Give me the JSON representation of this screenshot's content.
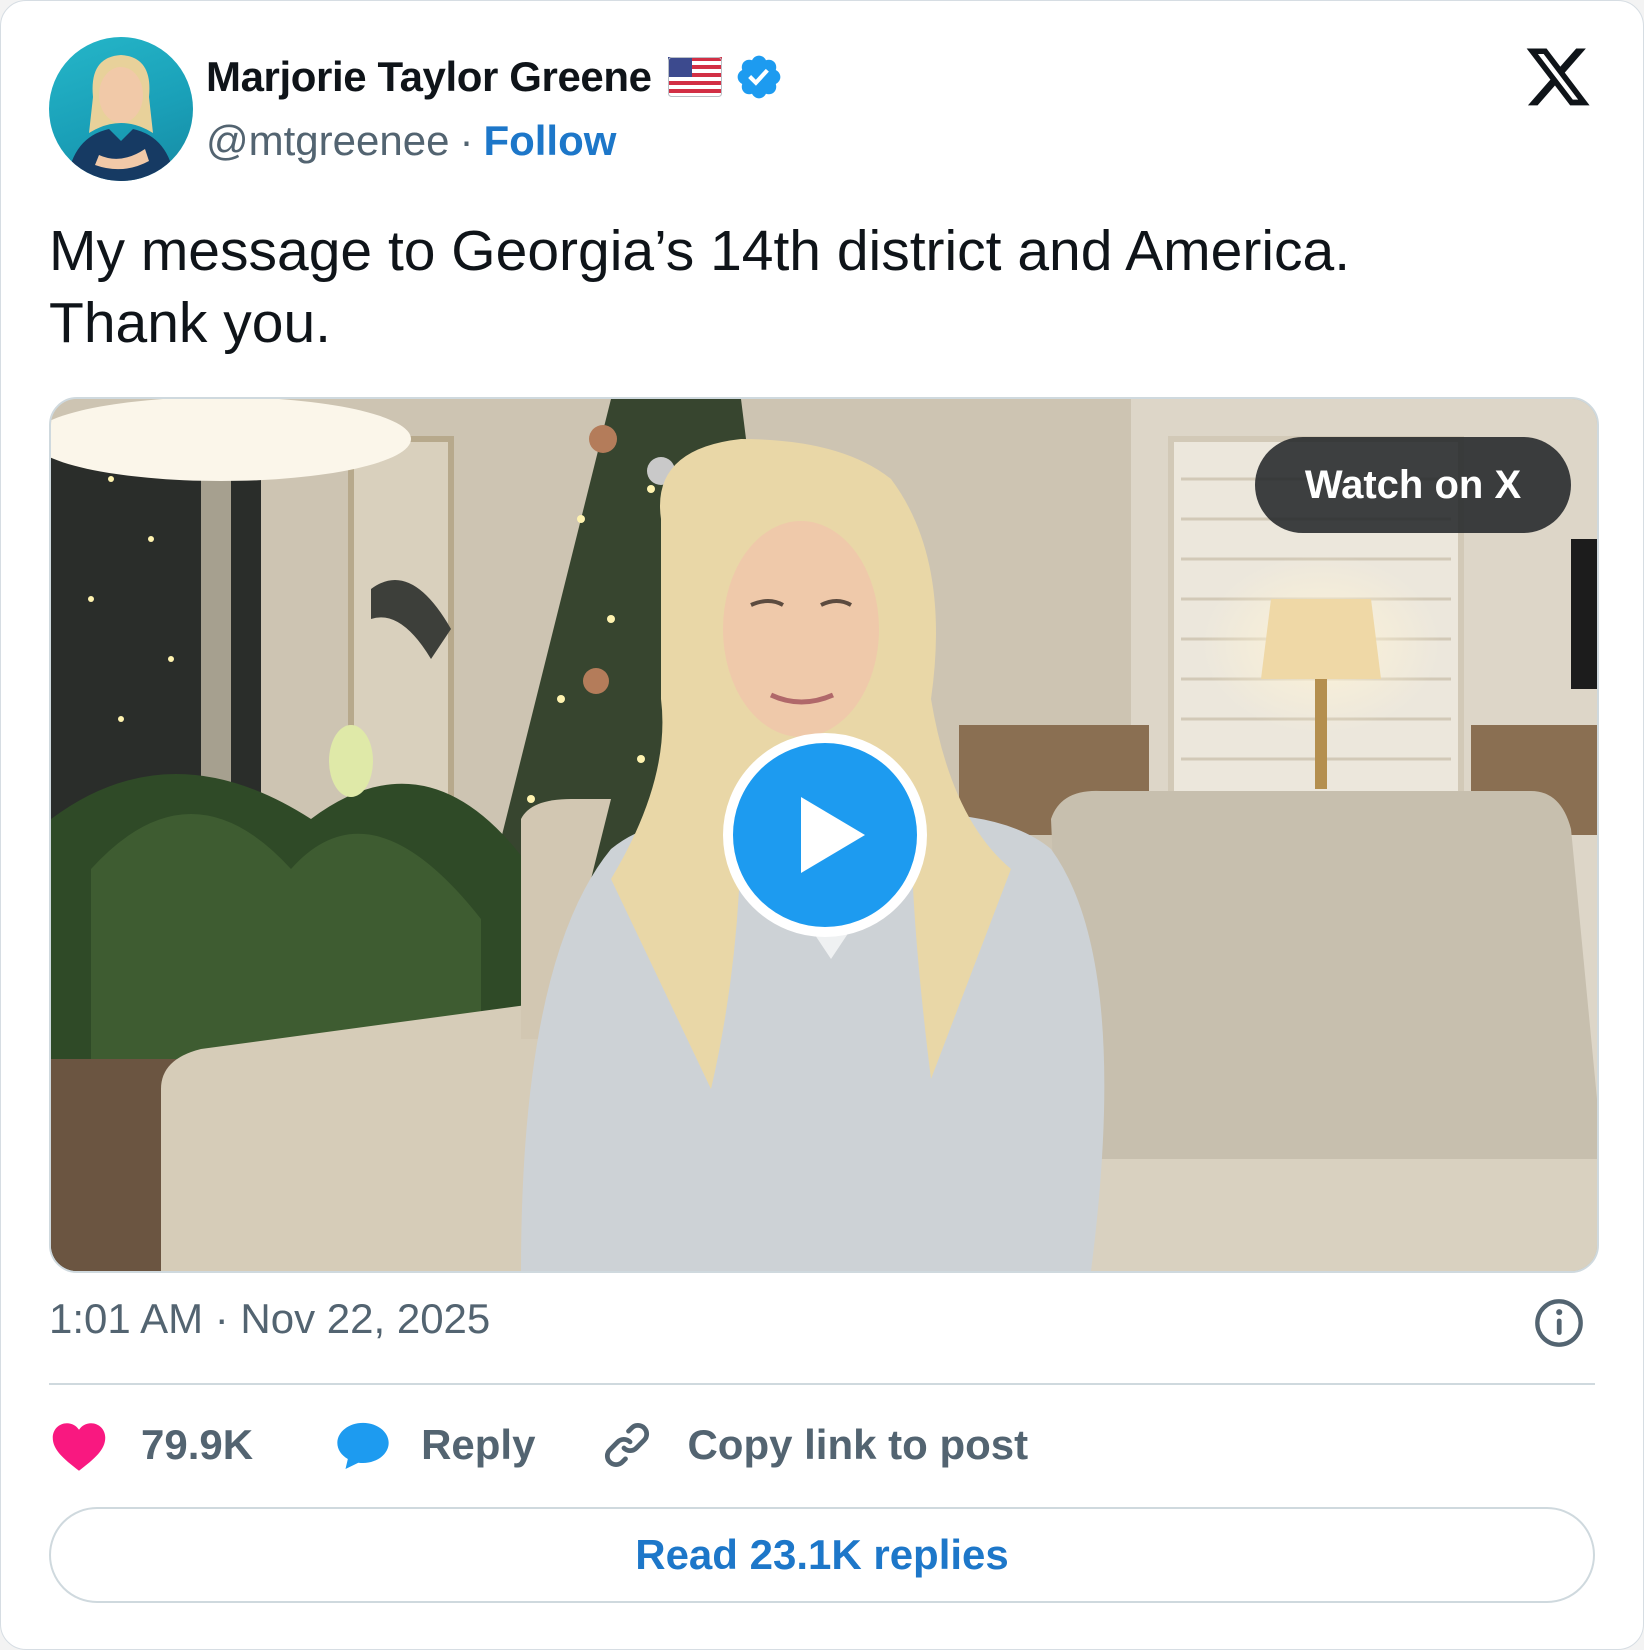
{
  "author": {
    "name": "Marjorie Taylor Greene",
    "handle": "@mtgreenee",
    "separator": "·",
    "follow_label": "Follow",
    "flag_icon": "us-flag-icon",
    "verified_icon": "verified-badge-icon"
  },
  "post": {
    "text_lines": [
      "My message to Georgia’s 14th district and America.",
      "Thank you."
    ],
    "timestamp": "1:01 AM · Nov 22, 2025"
  },
  "video": {
    "watch_label": "Watch on X",
    "play_icon": "play-icon"
  },
  "actions": {
    "likes": "79.9K",
    "reply_label": "Reply",
    "copy_label": "Copy link to post"
  },
  "footer": {
    "read_replies_label": "Read 23.1K replies"
  },
  "colors": {
    "accent_blue": "#1d9bf0",
    "link_blue": "#1d77c9",
    "like_pink": "#f91880",
    "text_secondary": "#536471",
    "border": "#cfd9de"
  }
}
